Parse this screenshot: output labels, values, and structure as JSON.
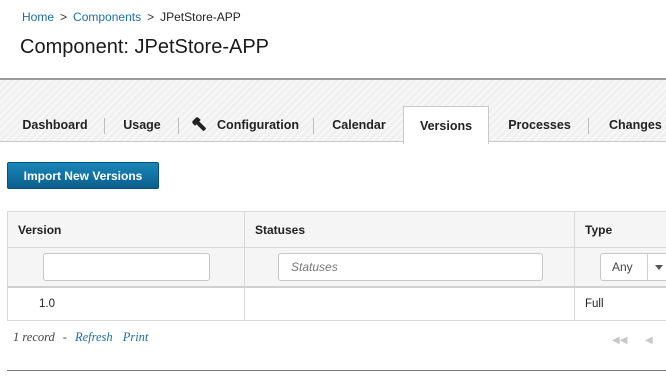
{
  "breadcrumb": {
    "home": "Home",
    "separator": ">",
    "components": "Components",
    "current": "JPetStore-APP"
  },
  "page": {
    "title": "Component: JPetStore-APP"
  },
  "tabs": [
    {
      "label": "Dashboard"
    },
    {
      "label": "Usage"
    },
    {
      "label": "Configuration",
      "icon": "wrench-icon"
    },
    {
      "label": "Calendar"
    },
    {
      "label": "Versions",
      "active": true
    },
    {
      "label": "Processes"
    },
    {
      "label": "Changes"
    }
  ],
  "toolbar": {
    "import_label": "Import New Versions"
  },
  "table": {
    "columns": [
      "Version",
      "Statuses",
      "Type"
    ],
    "filters": {
      "version_value": "",
      "statuses_placeholder": "Statuses",
      "type_selected": "Any"
    },
    "rows": [
      {
        "version": "1.0",
        "statuses": "",
        "type": "Full"
      }
    ]
  },
  "footer": {
    "record_count": "1 record",
    "dash": "-",
    "refresh": "Refresh",
    "print": "Print"
  },
  "pager": {
    "first": "◀◀",
    "prev": "◀"
  },
  "colors": {
    "accent": "#1d6fa5",
    "button": "#0b5f8e"
  }
}
